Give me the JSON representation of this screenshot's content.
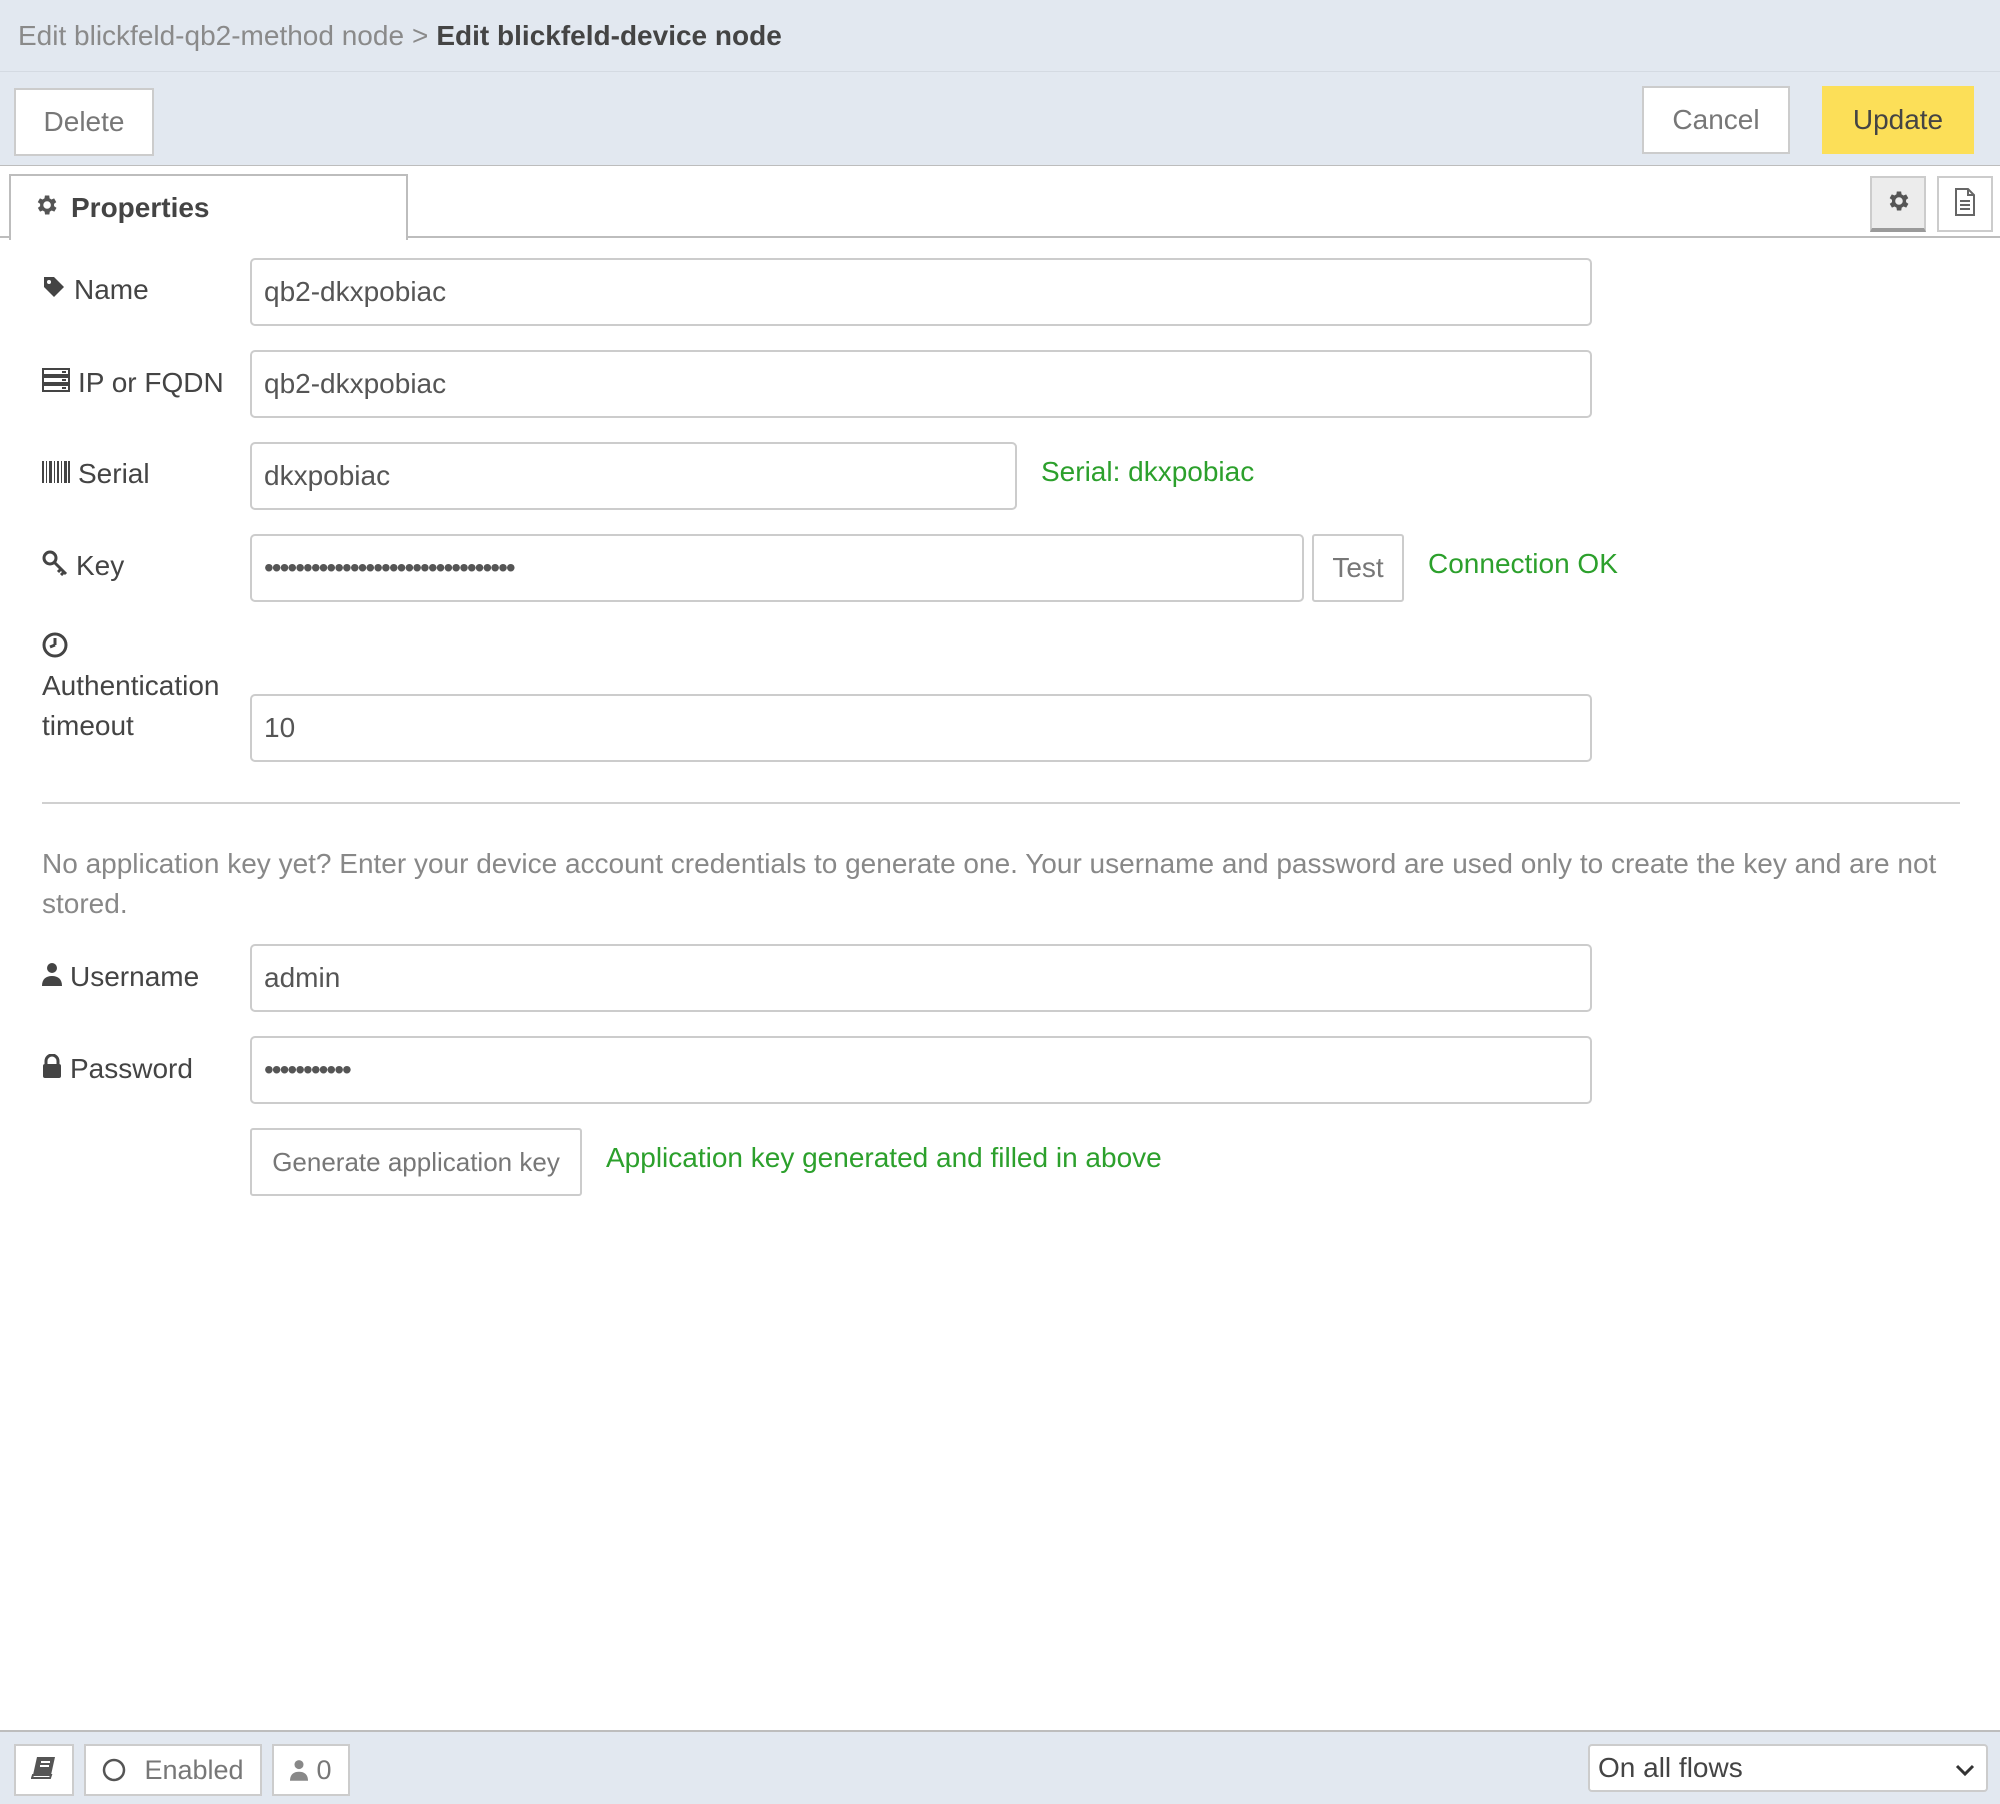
{
  "header": {
    "breadcrumb_prev": "Edit blickfeld-qb2-method node",
    "breadcrumb_sep": ">",
    "breadcrumb_current": "Edit blickfeld-device node"
  },
  "toolbar": {
    "delete_label": "Delete",
    "cancel_label": "Cancel",
    "update_label": "Update",
    "update_color": "#fcdf58"
  },
  "tabs": {
    "properties_label": "Properties",
    "icons": [
      "gear-icon",
      "document-icon"
    ]
  },
  "form": {
    "name": {
      "label": "Name",
      "value": "qb2-dkxpobiac",
      "icon": "tag-icon"
    },
    "host": {
      "label": "IP or FQDN",
      "value": "qb2-dkxpobiac",
      "icon": "server-icon"
    },
    "serial": {
      "label": "Serial",
      "value": "dkxpobiac",
      "status": "Serial: dkxpobiac",
      "icon": "barcode-icon"
    },
    "key": {
      "label": "Key",
      "value": "••••••••••••••••••••••••••••••••",
      "test_label": "Test",
      "status": "Connection OK",
      "icon": "key-icon"
    },
    "timeout": {
      "label_line1": "Authentication",
      "label_line2": "timeout",
      "value": "10",
      "icon": "clock-icon"
    },
    "help_text": "No application key yet? Enter your device account credentials to generate one. Your username and password are used only to create the key and are not stored.",
    "username": {
      "label": "Username",
      "value": "admin",
      "icon": "user-icon"
    },
    "password": {
      "label": "Password",
      "value": "•••••••••••",
      "icon": "lock-icon"
    },
    "generate_label": "Generate application key",
    "generate_status": "Application key generated and filled in above",
    "status_color": "#2ca02c"
  },
  "footer": {
    "enabled_label": "Enabled",
    "users_count": "0",
    "scope_select": "On all flows"
  }
}
